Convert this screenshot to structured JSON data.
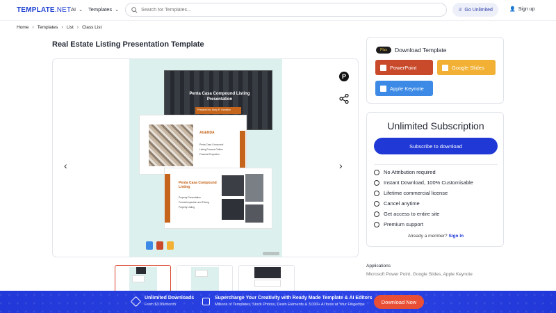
{
  "header": {
    "logo": "TEMPLATE",
    "logo_suffix": ".NET",
    "nav_ai": "AI",
    "nav_templates": "Templates",
    "search_placeholder": "Search for Templates...",
    "go_unlimited": "Go Unlimited",
    "signup": "Sign up"
  },
  "breadcrumb": [
    "Home",
    "Templates",
    "List",
    "Class List"
  ],
  "page_title": "Real Estate Listing Presentation Template",
  "preview": {
    "slide1_title": "Penta Casa Compound Listing Presentation",
    "slide1_tag": "Prepared by: Mary R. Hamilton",
    "slide2_heading": "AGENDA",
    "slide2_items": [
      "Penta Casa Compound",
      "Listing Process Outline",
      "Financial Projection"
    ],
    "slide3_heading": "Penta Casa Compound Listing",
    "slide3_items": [
      "Property Presentation",
      "Format Inspection and Pricing",
      "Property Listing"
    ]
  },
  "download": {
    "badge": "Plus",
    "title": "Download Template",
    "powerpoint": "PowerPoint",
    "google_slides": "Google Slides",
    "apple_keynote": "Apple Keynote"
  },
  "subscription": {
    "title": "Unlimited Subscription",
    "button": "Subscribe to download",
    "features": [
      "No Attribution required",
      "Instant Download, 100% Customisable",
      "Lifetime commercial license",
      "Cancel anytime",
      "Get access to entire site",
      "Premium support"
    ],
    "member_text": "Already a member?",
    "sign_in": "Sign In"
  },
  "applications": {
    "label": "Applications",
    "value": "Microsoft Power Point, Google Slides, Apple Keynote"
  },
  "banner": {
    "t1": "Unlimited Downloads",
    "s1": "From $3.99/month",
    "t2": "Supercharge Your Creativity with Ready Made Template & AI Editors",
    "s2": "Millions of Templates, Stock Photos, Desin Elements & 3,000+ AI tools at Your Fingertips",
    "button": "Download Now"
  },
  "colors": {
    "brand": "#1c3fd0",
    "accent_orange": "#c5651b",
    "cta_red": "#e94f35"
  }
}
